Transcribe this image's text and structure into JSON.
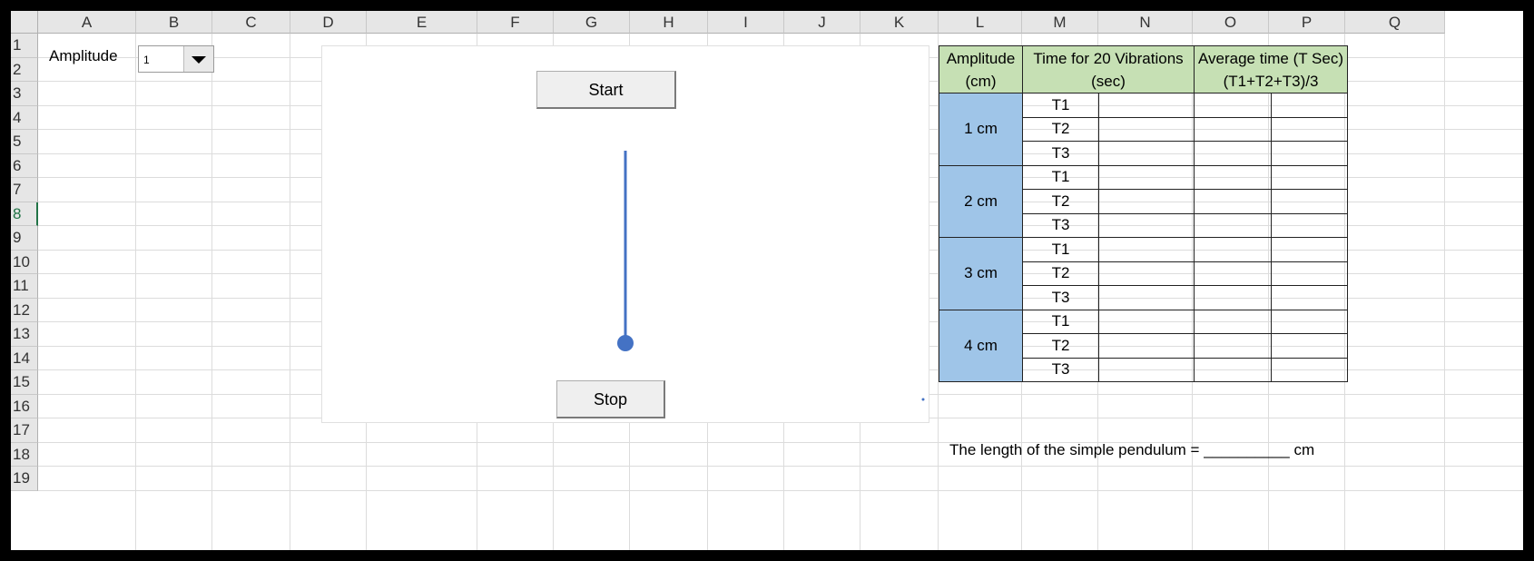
{
  "sheet": {
    "columns": [
      "A",
      "B",
      "C",
      "D",
      "E",
      "F",
      "G",
      "H",
      "I",
      "J",
      "K",
      "L",
      "M",
      "N",
      "O",
      "P",
      "Q"
    ],
    "rows": [
      "1",
      "2",
      "3",
      "4",
      "5",
      "6",
      "7",
      "8",
      "9",
      "10",
      "11",
      "12",
      "13",
      "14",
      "15",
      "16",
      "17",
      "18",
      "19"
    ],
    "selected_row": "8"
  },
  "cells": {
    "a1": "Amplitude",
    "footer_note": "The length of the simple pendulum = __________ cm"
  },
  "dropdown": {
    "value": "1"
  },
  "simulation": {
    "start_label": "Start",
    "stop_label": "Stop",
    "pendulum_color": "#4472c4"
  },
  "table": {
    "headers": {
      "amplitude": "Amplitude (cm)",
      "time": "Time for 20 Vibrations (sec)",
      "average": "Average time (T Sec) (T1+T2+T3)/3"
    },
    "groups": [
      {
        "amplitude": "1 cm",
        "trials": [
          "T1",
          "T2",
          "T3"
        ]
      },
      {
        "amplitude": "2 cm",
        "trials": [
          "T1",
          "T2",
          "T3"
        ]
      },
      {
        "amplitude": "3 cm",
        "trials": [
          "T1",
          "T2",
          "T3"
        ]
      },
      {
        "amplitude": "4 cm",
        "trials": [
          "T1",
          "T2",
          "T3"
        ]
      }
    ],
    "header_color": "#c6e0b4",
    "amplitude_color": "#9fc5e8"
  }
}
